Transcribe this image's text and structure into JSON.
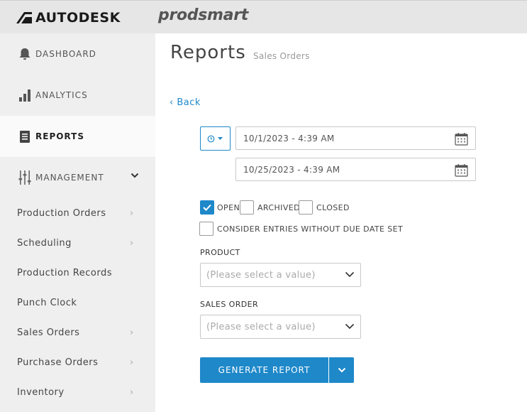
{
  "header": {
    "brand": "AUTODESK",
    "product": "prodsmart"
  },
  "sidebar": {
    "main_items": [
      {
        "label": "DASHBOARD",
        "icon": "bell-icon"
      },
      {
        "label": "ANALYTICS",
        "icon": "bar-chart-icon"
      },
      {
        "label": "REPORTS",
        "icon": "document-icon",
        "active": true
      },
      {
        "label": "MANAGEMENT",
        "icon": "sliders-icon",
        "expanded": true
      }
    ],
    "sub_items": [
      {
        "label": "Production Orders",
        "has_arrow": true
      },
      {
        "label": "Scheduling",
        "has_arrow": true
      },
      {
        "label": "Production Records",
        "has_arrow": false
      },
      {
        "label": "Punch Clock",
        "has_arrow": false
      },
      {
        "label": "Sales Orders",
        "has_arrow": true
      },
      {
        "label": "Purchase Orders",
        "has_arrow": true
      },
      {
        "label": "Inventory",
        "has_arrow": true
      }
    ],
    "arrow_glyph": "›"
  },
  "main": {
    "title": "Reports",
    "subtitle": "Sales Orders",
    "back_label": "‹ Back",
    "date_from": "10/1/2023 - 4:39 AM",
    "date_to": "10/25/2023 - 4:39 AM",
    "status_filters": {
      "open_label": "OPEN",
      "open_checked": true,
      "archived_label": "ARCHIVED",
      "archived_checked": false,
      "closed_label": "CLOSED",
      "closed_checked": false
    },
    "consider_label": "CONSIDER ENTRIES WITHOUT DUE DATE SET",
    "consider_checked": false,
    "product_label": "PRODUCT",
    "product_placeholder": "(Please select a value)",
    "sales_order_label": "SALES ORDER",
    "sales_order_placeholder": "(Please select a value)",
    "generate_label": "GENERATE REPORT"
  },
  "colors": {
    "accent": "#1e88c9",
    "sidebar_bg": "#efefef",
    "topbar_bg": "#e6e6e6"
  }
}
